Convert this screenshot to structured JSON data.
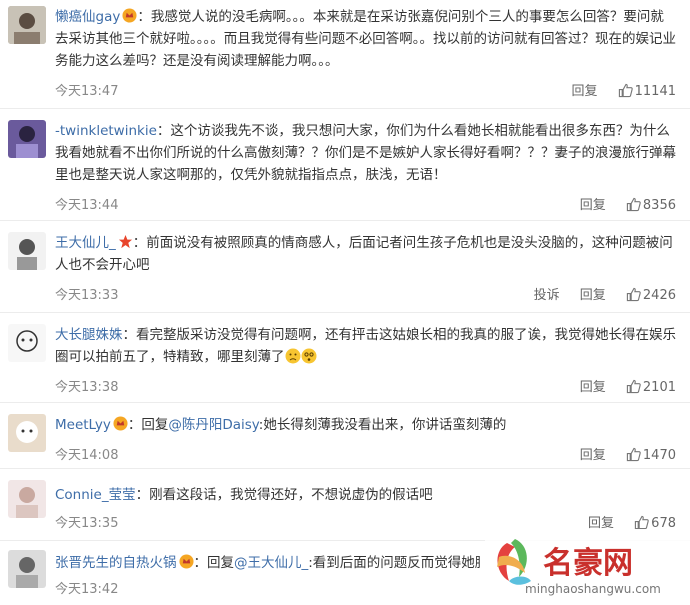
{
  "comments": [
    {
      "name": "懒癌仙gay",
      "text": "：我感觉人说的没毛病啊。。。本来就是在采访张嘉倪问别个三人的事要怎么回答？要问就去采访其他三个就好啦。。。。而且我觉得有些问题不必回答啊。。找以前的访问就有回答过？现在的娱记业务能力这么差吗？还是没有阅读理解能力啊。。。",
      "time": "今天13:47",
      "reply": "回复",
      "likes": "11141"
    },
    {
      "name": "-twinkletwinkie",
      "text": "：这个访谈我先不谈，我只想问大家，你们为什么看她长相就能看出很多东西？为什么我看她就看不出你们所说的什么高傲刻薄？？你们是不是嫉妒人家长得好看啊？？？妻子的浪漫旅行弹幕里也是整天说人家这啊那的，仅凭外貌就指指点点，肤浅，无语！",
      "time": "今天13:44",
      "reply": "回复",
      "likes": "8356"
    },
    {
      "name": "王大仙儿_",
      "text": "：前面说没有被照顾真的情商感人，后面记者问生孩子危机也是没头没脑的，这种问题被问人也不会开心吧",
      "time": "今天13:33",
      "report": "投诉",
      "reply": "回复",
      "likes": "2426"
    },
    {
      "name": "大长腿姝姝",
      "text": "：看完整版采访没觉得有问题啊，还有抨击这姑娘长相的我真的服了诶，我觉得她长得在娱乐圈可以拍前五了，特精致，哪里刻薄了",
      "time": "今天13:38",
      "reply": "回复",
      "likes": "2101"
    },
    {
      "name": "MeetLyy",
      "text_prefix": "：回复",
      "mention": "@陈丹阳Daisy",
      "text_suffix": ":她长得刻薄我没看出来，你讲话蛮刻薄的",
      "time": "今天14:08",
      "reply": "回复",
      "likes": "1470"
    },
    {
      "name": "Connie_莹莹",
      "text": "：刚看这段话，我觉得还好，不想说虚伪的假话吧",
      "time": "今天13:35",
      "reply": "回复",
      "likes": "678"
    },
    {
      "name": "张晋先生的自热火锅",
      "text_prefix": "：回复",
      "mention": "@王大仙儿_",
      "text_suffix": ":看到后面的问题反而觉得她脾气真",
      "time": "今天13:42"
    }
  ],
  "watermark": {
    "brand": "名豪网",
    "url": "minghaoshangwu.com"
  },
  "colors": {
    "name": "#3e6da8",
    "time": "#888888",
    "accent_star": "#e8452c"
  }
}
